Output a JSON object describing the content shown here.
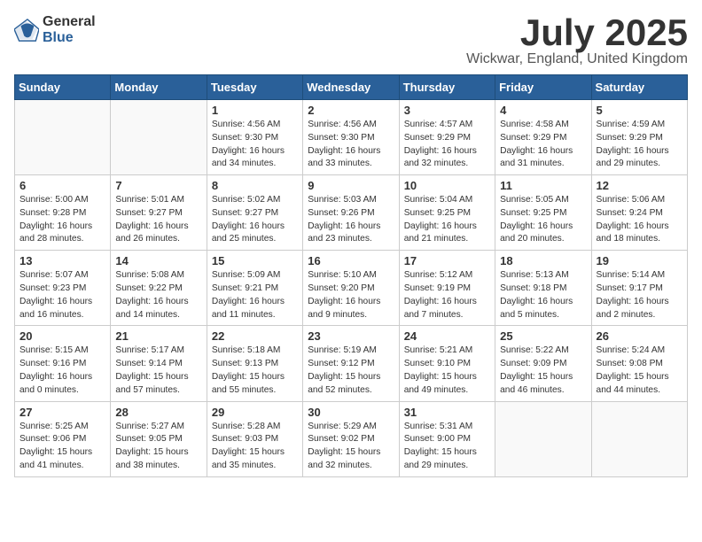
{
  "logo": {
    "general": "General",
    "blue": "Blue"
  },
  "title": {
    "month_year": "July 2025",
    "location": "Wickwar, England, United Kingdom"
  },
  "weekdays": [
    "Sunday",
    "Monday",
    "Tuesday",
    "Wednesday",
    "Thursday",
    "Friday",
    "Saturday"
  ],
  "weeks": [
    [
      {
        "day": "",
        "info": ""
      },
      {
        "day": "",
        "info": ""
      },
      {
        "day": "1",
        "info": "Sunrise: 4:56 AM\nSunset: 9:30 PM\nDaylight: 16 hours\nand 34 minutes."
      },
      {
        "day": "2",
        "info": "Sunrise: 4:56 AM\nSunset: 9:30 PM\nDaylight: 16 hours\nand 33 minutes."
      },
      {
        "day": "3",
        "info": "Sunrise: 4:57 AM\nSunset: 9:29 PM\nDaylight: 16 hours\nand 32 minutes."
      },
      {
        "day": "4",
        "info": "Sunrise: 4:58 AM\nSunset: 9:29 PM\nDaylight: 16 hours\nand 31 minutes."
      },
      {
        "day": "5",
        "info": "Sunrise: 4:59 AM\nSunset: 9:29 PM\nDaylight: 16 hours\nand 29 minutes."
      }
    ],
    [
      {
        "day": "6",
        "info": "Sunrise: 5:00 AM\nSunset: 9:28 PM\nDaylight: 16 hours\nand 28 minutes."
      },
      {
        "day": "7",
        "info": "Sunrise: 5:01 AM\nSunset: 9:27 PM\nDaylight: 16 hours\nand 26 minutes."
      },
      {
        "day": "8",
        "info": "Sunrise: 5:02 AM\nSunset: 9:27 PM\nDaylight: 16 hours\nand 25 minutes."
      },
      {
        "day": "9",
        "info": "Sunrise: 5:03 AM\nSunset: 9:26 PM\nDaylight: 16 hours\nand 23 minutes."
      },
      {
        "day": "10",
        "info": "Sunrise: 5:04 AM\nSunset: 9:25 PM\nDaylight: 16 hours\nand 21 minutes."
      },
      {
        "day": "11",
        "info": "Sunrise: 5:05 AM\nSunset: 9:25 PM\nDaylight: 16 hours\nand 20 minutes."
      },
      {
        "day": "12",
        "info": "Sunrise: 5:06 AM\nSunset: 9:24 PM\nDaylight: 16 hours\nand 18 minutes."
      }
    ],
    [
      {
        "day": "13",
        "info": "Sunrise: 5:07 AM\nSunset: 9:23 PM\nDaylight: 16 hours\nand 16 minutes."
      },
      {
        "day": "14",
        "info": "Sunrise: 5:08 AM\nSunset: 9:22 PM\nDaylight: 16 hours\nand 14 minutes."
      },
      {
        "day": "15",
        "info": "Sunrise: 5:09 AM\nSunset: 9:21 PM\nDaylight: 16 hours\nand 11 minutes."
      },
      {
        "day": "16",
        "info": "Sunrise: 5:10 AM\nSunset: 9:20 PM\nDaylight: 16 hours\nand 9 minutes."
      },
      {
        "day": "17",
        "info": "Sunrise: 5:12 AM\nSunset: 9:19 PM\nDaylight: 16 hours\nand 7 minutes."
      },
      {
        "day": "18",
        "info": "Sunrise: 5:13 AM\nSunset: 9:18 PM\nDaylight: 16 hours\nand 5 minutes."
      },
      {
        "day": "19",
        "info": "Sunrise: 5:14 AM\nSunset: 9:17 PM\nDaylight: 16 hours\nand 2 minutes."
      }
    ],
    [
      {
        "day": "20",
        "info": "Sunrise: 5:15 AM\nSunset: 9:16 PM\nDaylight: 16 hours\nand 0 minutes."
      },
      {
        "day": "21",
        "info": "Sunrise: 5:17 AM\nSunset: 9:14 PM\nDaylight: 15 hours\nand 57 minutes."
      },
      {
        "day": "22",
        "info": "Sunrise: 5:18 AM\nSunset: 9:13 PM\nDaylight: 15 hours\nand 55 minutes."
      },
      {
        "day": "23",
        "info": "Sunrise: 5:19 AM\nSunset: 9:12 PM\nDaylight: 15 hours\nand 52 minutes."
      },
      {
        "day": "24",
        "info": "Sunrise: 5:21 AM\nSunset: 9:10 PM\nDaylight: 15 hours\nand 49 minutes."
      },
      {
        "day": "25",
        "info": "Sunrise: 5:22 AM\nSunset: 9:09 PM\nDaylight: 15 hours\nand 46 minutes."
      },
      {
        "day": "26",
        "info": "Sunrise: 5:24 AM\nSunset: 9:08 PM\nDaylight: 15 hours\nand 44 minutes."
      }
    ],
    [
      {
        "day": "27",
        "info": "Sunrise: 5:25 AM\nSunset: 9:06 PM\nDaylight: 15 hours\nand 41 minutes."
      },
      {
        "day": "28",
        "info": "Sunrise: 5:27 AM\nSunset: 9:05 PM\nDaylight: 15 hours\nand 38 minutes."
      },
      {
        "day": "29",
        "info": "Sunrise: 5:28 AM\nSunset: 9:03 PM\nDaylight: 15 hours\nand 35 minutes."
      },
      {
        "day": "30",
        "info": "Sunrise: 5:29 AM\nSunset: 9:02 PM\nDaylight: 15 hours\nand 32 minutes."
      },
      {
        "day": "31",
        "info": "Sunrise: 5:31 AM\nSunset: 9:00 PM\nDaylight: 15 hours\nand 29 minutes."
      },
      {
        "day": "",
        "info": ""
      },
      {
        "day": "",
        "info": ""
      }
    ]
  ]
}
